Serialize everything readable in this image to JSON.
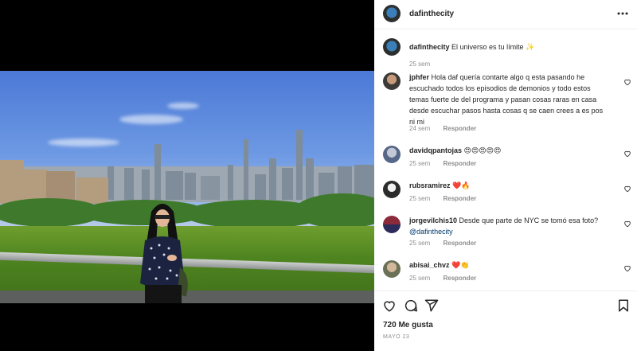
{
  "post": {
    "username": "dafinthecity",
    "caption": {
      "user": "dafinthecity",
      "text": "El universo es tu límite ✨",
      "time": "25 sem"
    },
    "comments": [
      {
        "user": "jphfer",
        "text": "Hola daf quería contarte algo q esta pasando he escuchado todos los episodios de demonios y todo estos temas fuerte de del programa y pasan cosas raras en casa desde escuchar pasos hasta cosas q se caen crees a es pos ni mi",
        "time": "24 sem",
        "reply": "Responder"
      },
      {
        "user": "davidqpantojas",
        "text": "😍😍😍😍😍",
        "time": "25 sem",
        "reply": "Responder"
      },
      {
        "user": "rubsramirez",
        "text": "❤️🔥",
        "time": "25 sem",
        "reply": "Responder"
      },
      {
        "user": "jorgevilchis10",
        "text": "Desde que parte de NYC se tomó esa foto?",
        "mention": "@dafinthecity",
        "time": "25 sem",
        "reply": "Responder"
      },
      {
        "user": "abisai_chvz",
        "text": "❤️👏",
        "time": "25 sem",
        "reply": "Responder"
      }
    ],
    "likes": "720 Me gusta",
    "date": "MAYO 23"
  },
  "icons": [
    "more-icon",
    "heart-icon",
    "comment-icon",
    "share-icon",
    "bookmark-icon"
  ]
}
